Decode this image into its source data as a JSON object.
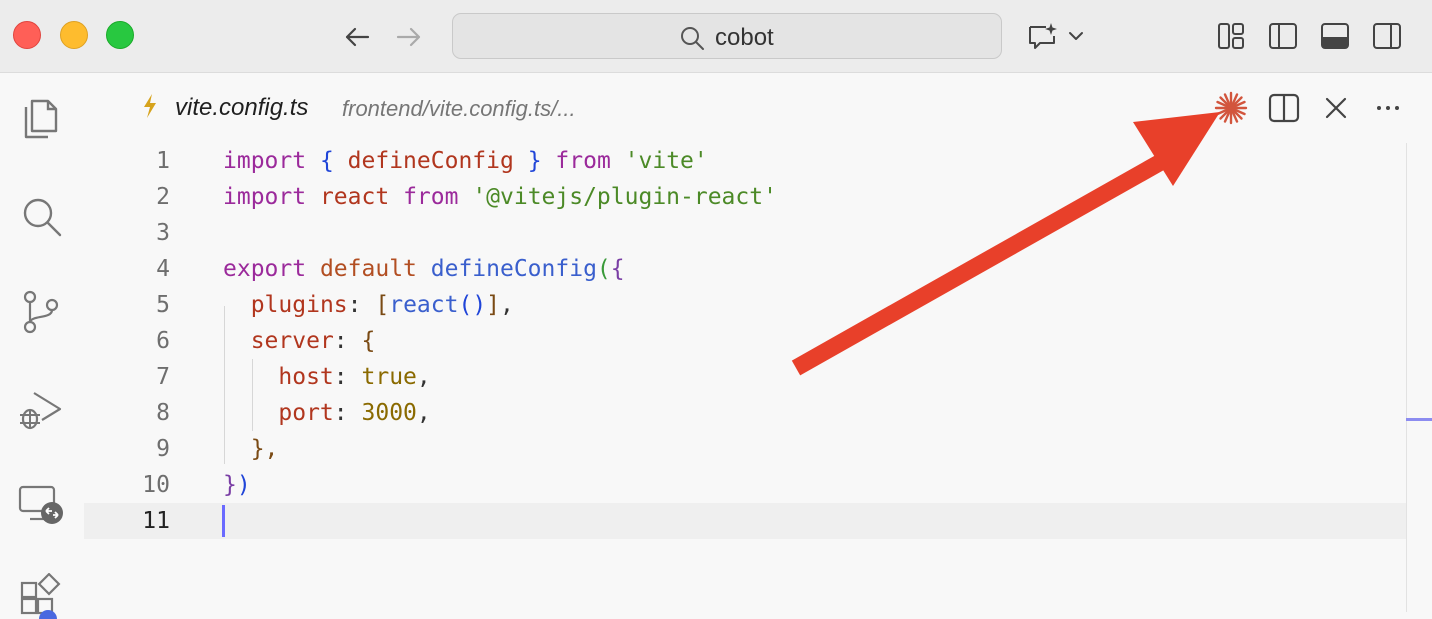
{
  "titlebar": {
    "search_text": "cobot"
  },
  "tab": {
    "filename": "vite.config.ts",
    "path": "frontend/vite.config.ts/..."
  },
  "editor": {
    "lines": [
      {
        "num": "1"
      },
      {
        "num": "2"
      },
      {
        "num": "3"
      },
      {
        "num": "4"
      },
      {
        "num": "5"
      },
      {
        "num": "6"
      },
      {
        "num": "7"
      },
      {
        "num": "8"
      },
      {
        "num": "9"
      },
      {
        "num": "10"
      },
      {
        "num": "11"
      }
    ],
    "tokens": {
      "import": "import",
      "lbrace": "{",
      "defineConfig": "defineConfig",
      "rbrace": "}",
      "from": "from",
      "vite_str": "'vite'",
      "react": "react",
      "plugin_str": "'@vitejs/plugin-react'",
      "export": "export",
      "default": "default",
      "paren_open": "(",
      "plugins": "plugins",
      "colon": ":",
      "lbracket": "[",
      "call_parens": "()",
      "rbracket": "]",
      "comma": ",",
      "server": "server",
      "host": "host",
      "true": "true",
      "port": "port",
      "port_value": "3000",
      "close_server": "},",
      "close_paren": ")"
    }
  },
  "colors": {
    "arrow": "#e8402a",
    "accent": "#6a6aff"
  },
  "icons": {
    "explorer": "files-icon",
    "search": "search-icon",
    "scm": "source-control-icon",
    "debug": "run-debug-icon",
    "remote": "remote-explorer-icon",
    "extensions": "extensions-icon"
  }
}
